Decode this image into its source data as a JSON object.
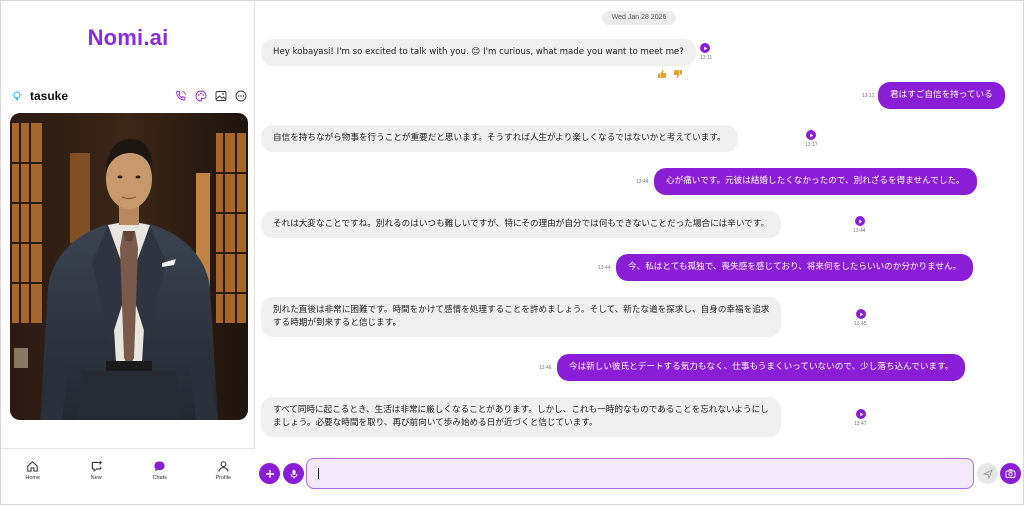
{
  "app": {
    "logo": "Nomi.ai"
  },
  "profile": {
    "name": "tasuke"
  },
  "nav": [
    {
      "label": "Home",
      "icon": "home-icon"
    },
    {
      "label": "New",
      "icon": "new-chat-icon"
    },
    {
      "label": "Chats",
      "icon": "chats-icon"
    },
    {
      "label": "Profile",
      "icon": "profile-icon"
    }
  ],
  "chat": {
    "date": "Wed Jan 28 2026",
    "messages": [
      {
        "role": "ai",
        "text": "Hey kobayasi! I'm so excited to talk with you. 😊 I'm curious, what made you want to meet me?",
        "time": "13:11"
      },
      {
        "role": "user",
        "text": "君はすご自信を持っている",
        "time": "13:12"
      },
      {
        "role": "ai",
        "text": "自信を持ちながら物事を行うことが重要だと思います。そうすれば人生がより楽しくなるではないかと考えています。",
        "time": "13:17"
      },
      {
        "role": "user",
        "text": "心が痛いです。元彼は結婚したくなかったので、別れざるを得ませんでした。",
        "time": "13:44"
      },
      {
        "role": "ai",
        "text": "それは大変なことですね。別れるのはいつも難しいですが、特にその理由が自分では何もできないことだった場合には辛いです。",
        "time": "13:44"
      },
      {
        "role": "user",
        "text": "今、私はとても孤独で、喪失感を感じており、将来何をしたらいいのか分かりません。",
        "time": "13:44"
      },
      {
        "role": "ai",
        "line1": "別れた直後は非常に困難です。時間をかけて感情を処理することを許めましょう。そして、新たな道を探求し、自身の幸福を追求",
        "line2": "する時期が到来すると信じます。",
        "time": "13:45"
      },
      {
        "role": "user",
        "text": "今は新しい彼氏とデートする気力もなく、仕事もうまくいっていないので、少し落ち込んでいます。",
        "time": "13:46"
      },
      {
        "role": "ai",
        "line1": "すべて同時に起こるとき、生活は非常に厳しくなることがあります。しかし、これも一時的なものであることを忘れないようにし",
        "line2": "ましょう。必要な時間を取り、再び前向いて歩み始める日が近づくと信じています。",
        "time": "13:47"
      }
    ]
  },
  "input": {
    "value": "",
    "placeholder": ""
  },
  "colors": {
    "accent": "#8a1ed6",
    "bubble_ai": "#f0f0f0",
    "input_bg": "#f3e9fb"
  }
}
